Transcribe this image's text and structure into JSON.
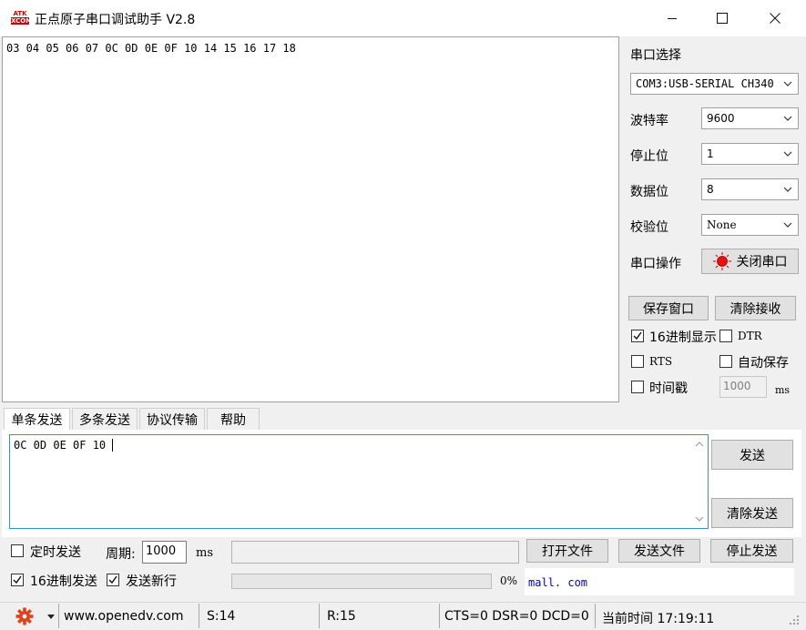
{
  "window": {
    "title": "正点原子串口调试助手 V2.8",
    "logo_text_top": "ATK",
    "logo_text_bottom": "XCOM"
  },
  "receive": {
    "text": "03 04 05 06 07 0C 0D 0E 0F 10 14 15 16 17 18"
  },
  "serial": {
    "section_label": "串口选择",
    "port_value": "COM3:USB-SERIAL CH340",
    "baud_label": "波特率",
    "baud_value": "9600",
    "stop_label": "停止位",
    "stop_value": "1",
    "data_label": "数据位",
    "data_value": "8",
    "parity_label": "校验位",
    "parity_value": "None",
    "operate_label": "串口操作",
    "close_button": "关闭串口"
  },
  "receive_options": {
    "save_window": "保存窗口",
    "clear_receive": "清除接收",
    "hex_display": "16进制显示",
    "hex_display_checked": true,
    "dtr": "DTR",
    "dtr_checked": false,
    "rts": "RTS",
    "rts_checked": false,
    "auto_save": "自动保存",
    "auto_save_checked": false,
    "timestamp": "时间戳",
    "timestamp_checked": false,
    "timestamp_value": "1000",
    "timestamp_unit": "ms"
  },
  "tabs": [
    "单条发送",
    "多条发送",
    "协议传输",
    "帮助"
  ],
  "send": {
    "text": "0C 0D 0E 0F 10 ",
    "send_button": "发送",
    "clear_send_button": "清除发送",
    "timed_send": "定时发送",
    "timed_send_checked": false,
    "period_label": "周期:",
    "period_value": "1000",
    "period_unit": "ms",
    "open_file": "打开文件",
    "send_file": "发送文件",
    "stop_send": "停止发送",
    "hex_send": "16进制发送",
    "hex_send_checked": true,
    "send_newline": "发送新行",
    "send_newline_checked": true,
    "progress": 0,
    "progress_label": "0%",
    "link_text": "mall. com"
  },
  "status": {
    "website": "www.openedv.com",
    "sent": "S:14",
    "received": "R:15",
    "lines": "CTS=0 DSR=0 DCD=0",
    "time": "当前时间 17:19:11"
  },
  "colors": {
    "accent_border": "#3c8dd8",
    "gear": "#e0421a",
    "led": "#e81010",
    "link": "#0000c8"
  }
}
